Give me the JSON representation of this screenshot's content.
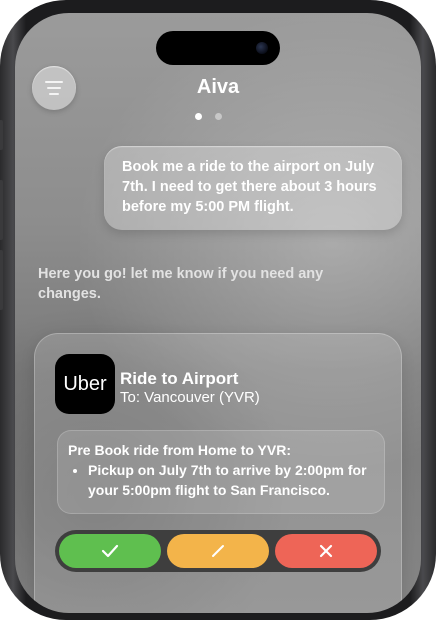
{
  "header": {
    "title": "Aiva",
    "page_indicator": {
      "pages": 2,
      "active": 1
    }
  },
  "icons": {
    "menu": "hamburger-icon",
    "confirm": "checkmark-icon",
    "edit": "pencil-icon",
    "cancel": "close-icon"
  },
  "messages": {
    "user": "Book me a ride to the airport on July 7th. I need to get there about 3 hours before my 5:00 PM flight.",
    "assistant": "Here you go! let me know if you need any changes."
  },
  "card": {
    "logo_text": "Uber",
    "title": "Ride to Airport",
    "destination": "To: Vancouver (YVR)",
    "details_heading": "Pre Book ride from Home to YVR:",
    "details_item": "Pickup on July 7th to arrive by 2:00pm for your 5:00pm flight to San Francisco."
  },
  "colors": {
    "confirm": "#5fbf4f",
    "edit": "#f3b44a",
    "cancel": "#ee6557",
    "logo_bg": "#000000"
  }
}
